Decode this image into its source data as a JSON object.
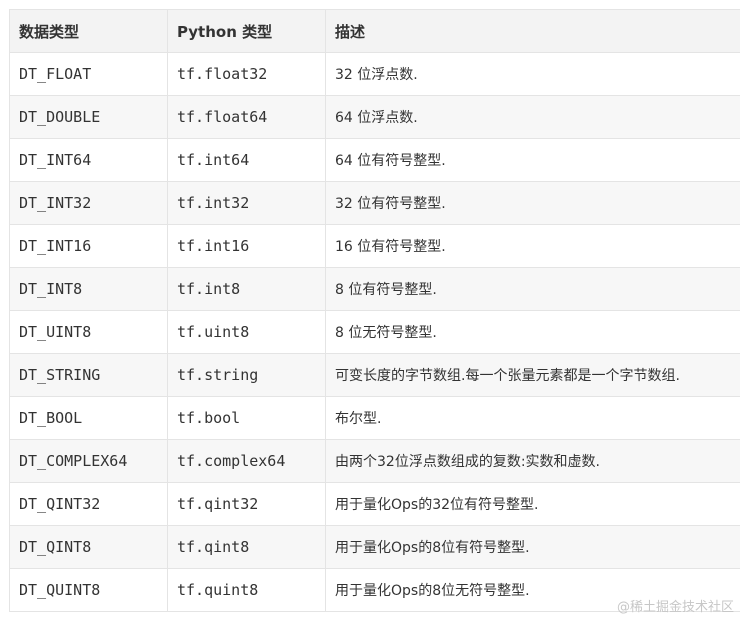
{
  "table": {
    "headers": [
      "数据类型",
      "Python 类型",
      "描述"
    ],
    "rows": [
      [
        "DT_FLOAT",
        "tf.float32",
        "32 位浮点数."
      ],
      [
        "DT_DOUBLE",
        "tf.float64",
        "64 位浮点数."
      ],
      [
        "DT_INT64",
        "tf.int64",
        "64 位有符号整型."
      ],
      [
        "DT_INT32",
        "tf.int32",
        "32 位有符号整型."
      ],
      [
        "DT_INT16",
        "tf.int16",
        "16 位有符号整型."
      ],
      [
        "DT_INT8",
        "tf.int8",
        "8 位有符号整型."
      ],
      [
        "DT_UINT8",
        "tf.uint8",
        "8 位无符号整型."
      ],
      [
        "DT_STRING",
        "tf.string",
        "可变长度的字节数组.每一个张量元素都是一个字节数组."
      ],
      [
        "DT_BOOL",
        "tf.bool",
        "布尔型."
      ],
      [
        "DT_COMPLEX64",
        "tf.complex64",
        "由两个32位浮点数组成的复数:实数和虚数."
      ],
      [
        "DT_QINT32",
        "tf.qint32",
        "用于量化Ops的32位有符号整型."
      ],
      [
        "DT_QINT8",
        "tf.qint8",
        "用于量化Ops的8位有符号整型."
      ],
      [
        "DT_QUINT8",
        "tf.quint8",
        "用于量化Ops的8位无符号整型."
      ]
    ]
  },
  "watermark": "@稀土掘金技术社区"
}
